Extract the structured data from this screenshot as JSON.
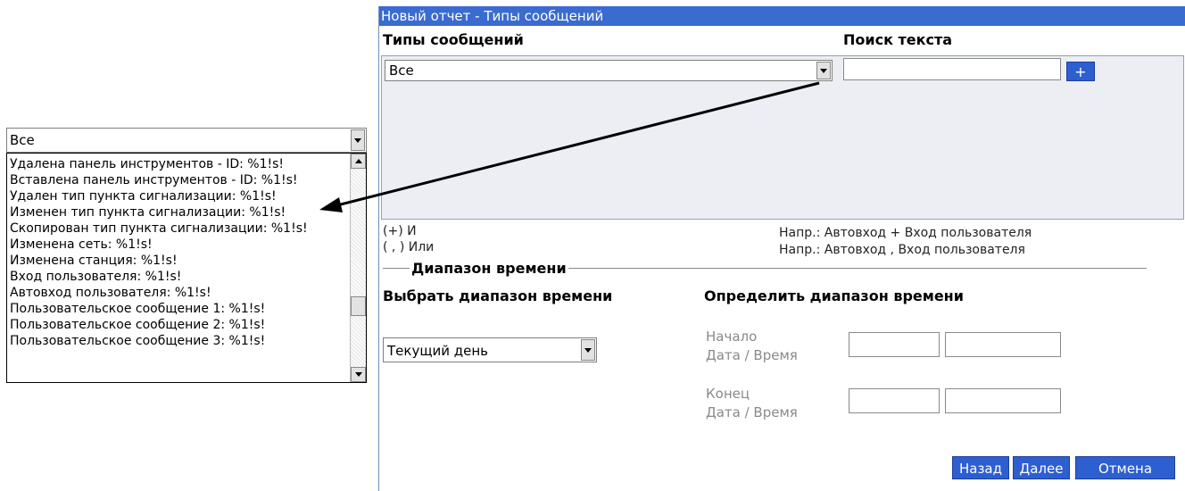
{
  "dialog": {
    "title": "Новый отчет - Типы сообщений",
    "message_types_header": "Типы сообщений",
    "search_text_header": "Поиск текста",
    "message_type_selected": "Все",
    "plus_button": "+",
    "and_hint": "(+) И",
    "or_hint": "( , ) Или",
    "and_example": "Напр.: Автовход + Вход пользователя",
    "or_example": "Напр.: Автовход , Вход пользователя",
    "time_range_legend": "Диапазон времени",
    "select_time_range_header": "Выбрать диапазон времени",
    "define_time_range_header": "Определить диапазон времени",
    "time_range_selected": "Текущий день",
    "start_label": "Начало",
    "start_sub": "Дата / Время",
    "end_label": "Конец",
    "end_sub": "Дата / Время",
    "back_button": "Назад",
    "next_button": "Далее",
    "cancel_button": "Отмена"
  },
  "expanded_dropdown": {
    "selected": "Все",
    "items": [
      "Удалена панель инструментов - ID: %1!s!",
      "Вставлена панель инструментов - ID: %1!s!",
      "Удален тип пункта сигнализации: %1!s!",
      "Изменен тип пункта сигнализации: %1!s!",
      "Скопирован тип пункта сигнализации: %1!s!",
      "Изменена сеть: %1!s!",
      "Изменена станция: %1!s!",
      "Вход пользователя: %1!s!",
      "Автовход пользователя: %1!s!",
      "Пользовательское сообщение 1: %1!s!",
      "Пользовательское сообщение 2: %1!s!",
      "Пользовательское сообщение 3: %1!s!"
    ]
  },
  "colors": {
    "title_bar": "#3a6bd0",
    "button": "#2e5fd0",
    "panel": "#eceef4"
  }
}
